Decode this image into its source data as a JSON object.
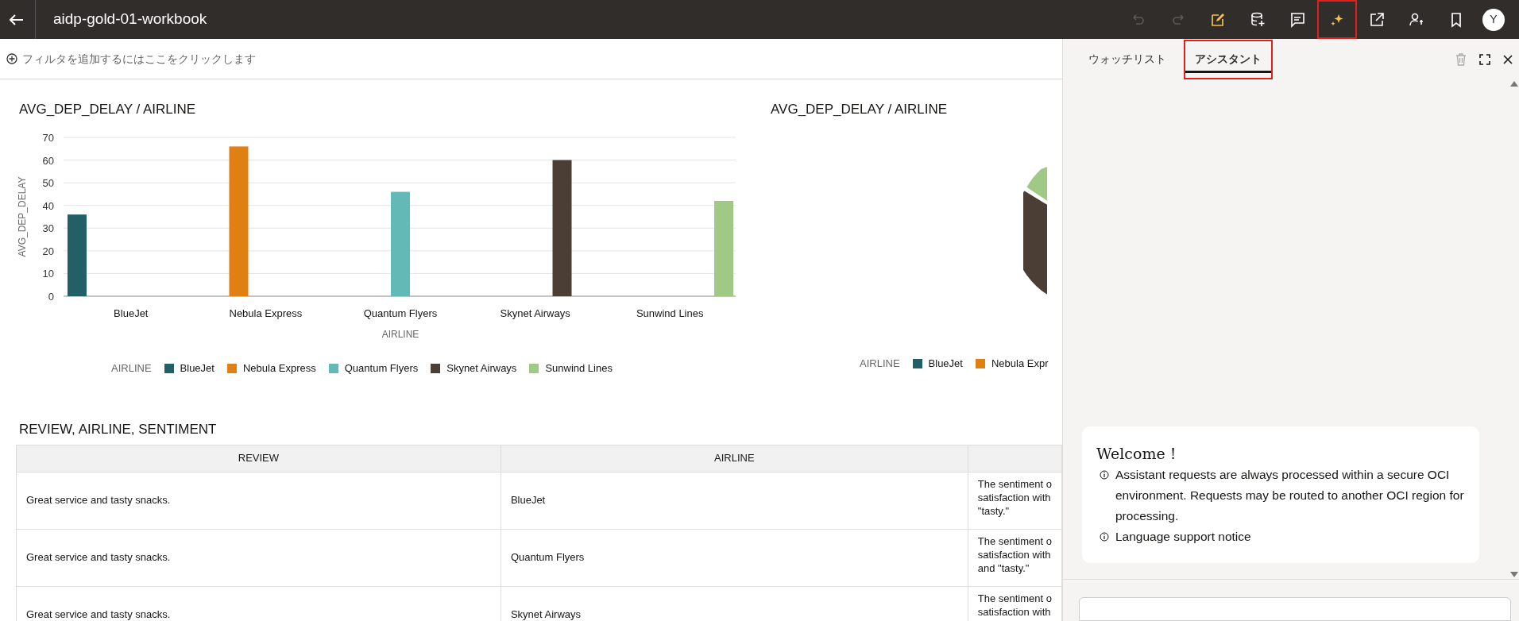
{
  "app_bar": {
    "title": "aidp-gold-01-workbook",
    "avatar": "Y",
    "toolbar": [
      {
        "disabled": true,
        "annotated": false
      },
      {
        "disabled": true,
        "annotated": false
      },
      {
        "disabled": false,
        "annotated": false
      },
      {
        "disabled": false,
        "annotated": false
      },
      {
        "disabled": false,
        "annotated": false
      },
      {
        "disabled": false,
        "annotated": true
      },
      {
        "disabled": false,
        "annotated": false
      },
      {
        "disabled": false,
        "annotated": false
      },
      {
        "disabled": false,
        "annotated": false
      }
    ]
  },
  "filter_bar": {
    "placeholder": "フィルタを追加するにはここをクリックします"
  },
  "bar_chart": {
    "chart_data": {
      "type": "bar",
      "title": "AVG_DEP_DELAY / AIRLINE",
      "xlabel": "AIRLINE",
      "ylabel": "AVG_DEP_DELAY",
      "categories": [
        "BlueJet",
        "Nebula Express",
        "Quantum Flyers",
        "Skynet Airways",
        "Sunwind Lines"
      ],
      "series": [
        {
          "name": "BlueJet",
          "color": "#225f66",
          "values": [
            36,
            null,
            null,
            null,
            null
          ]
        },
        {
          "name": "Nebula Express",
          "color": "#e07f12",
          "values": [
            null,
            66,
            null,
            null,
            null
          ]
        },
        {
          "name": "Quantum Flyers",
          "color": "#62b9b5",
          "values": [
            null,
            null,
            46,
            null,
            null
          ]
        },
        {
          "name": "Skynet Airways",
          "color": "#4b3f35",
          "values": [
            null,
            null,
            null,
            60,
            null
          ]
        },
        {
          "name": "Sunwind Lines",
          "color": "#a0c986",
          "values": [
            null,
            null,
            null,
            null,
            42
          ]
        }
      ],
      "ylim": [
        0,
        70
      ],
      "yticks": [
        0,
        10,
        20,
        30,
        40,
        50,
        60,
        70
      ],
      "grid": true,
      "legend": true
    },
    "legend_title": "AIRLINE"
  },
  "pie_chart": {
    "title": "AVG_DEP_DELAY / AIRLINE",
    "legend_title": "AIRLINE",
    "legend": [
      {
        "label": "BlueJet",
        "color": "#225f66"
      },
      {
        "label": "Nebula Expr",
        "color": "#e07f12"
      }
    ]
  },
  "table": {
    "title": "REVIEW, AIRLINE, SENTIMENT",
    "columns": [
      "REVIEW",
      "AIRLINE"
    ],
    "rows": [
      {
        "cells": [
          "Great service and tasty snacks.",
          "BlueJet"
        ],
        "sentiment_lines": [
          "The sentiment o",
          "satisfaction with",
          "\"tasty.\""
        ]
      },
      {
        "cells": [
          "Great service and tasty snacks.",
          "Quantum Flyers"
        ],
        "sentiment_lines": [
          "The sentiment o",
          "satisfaction with",
          "and \"tasty.\""
        ]
      },
      {
        "cells": [
          "Great service and tasty snacks.",
          "Skynet Airways"
        ],
        "sentiment_lines": [
          "The sentiment o",
          "satisfaction with"
        ]
      }
    ]
  },
  "side_panel": {
    "tabs": [
      {
        "label": "ウォッチリスト",
        "selected": false,
        "annotated": false
      },
      {
        "label": "アシスタント",
        "selected": true,
        "annotated": true
      }
    ],
    "delete_disabled": true,
    "welcome": {
      "title": "Welcome !",
      "notices": [
        "Assistant requests are always processed within a secure OCI environment. Requests may be routed to another OCI region for processing.",
        "Language support notice"
      ]
    }
  }
}
